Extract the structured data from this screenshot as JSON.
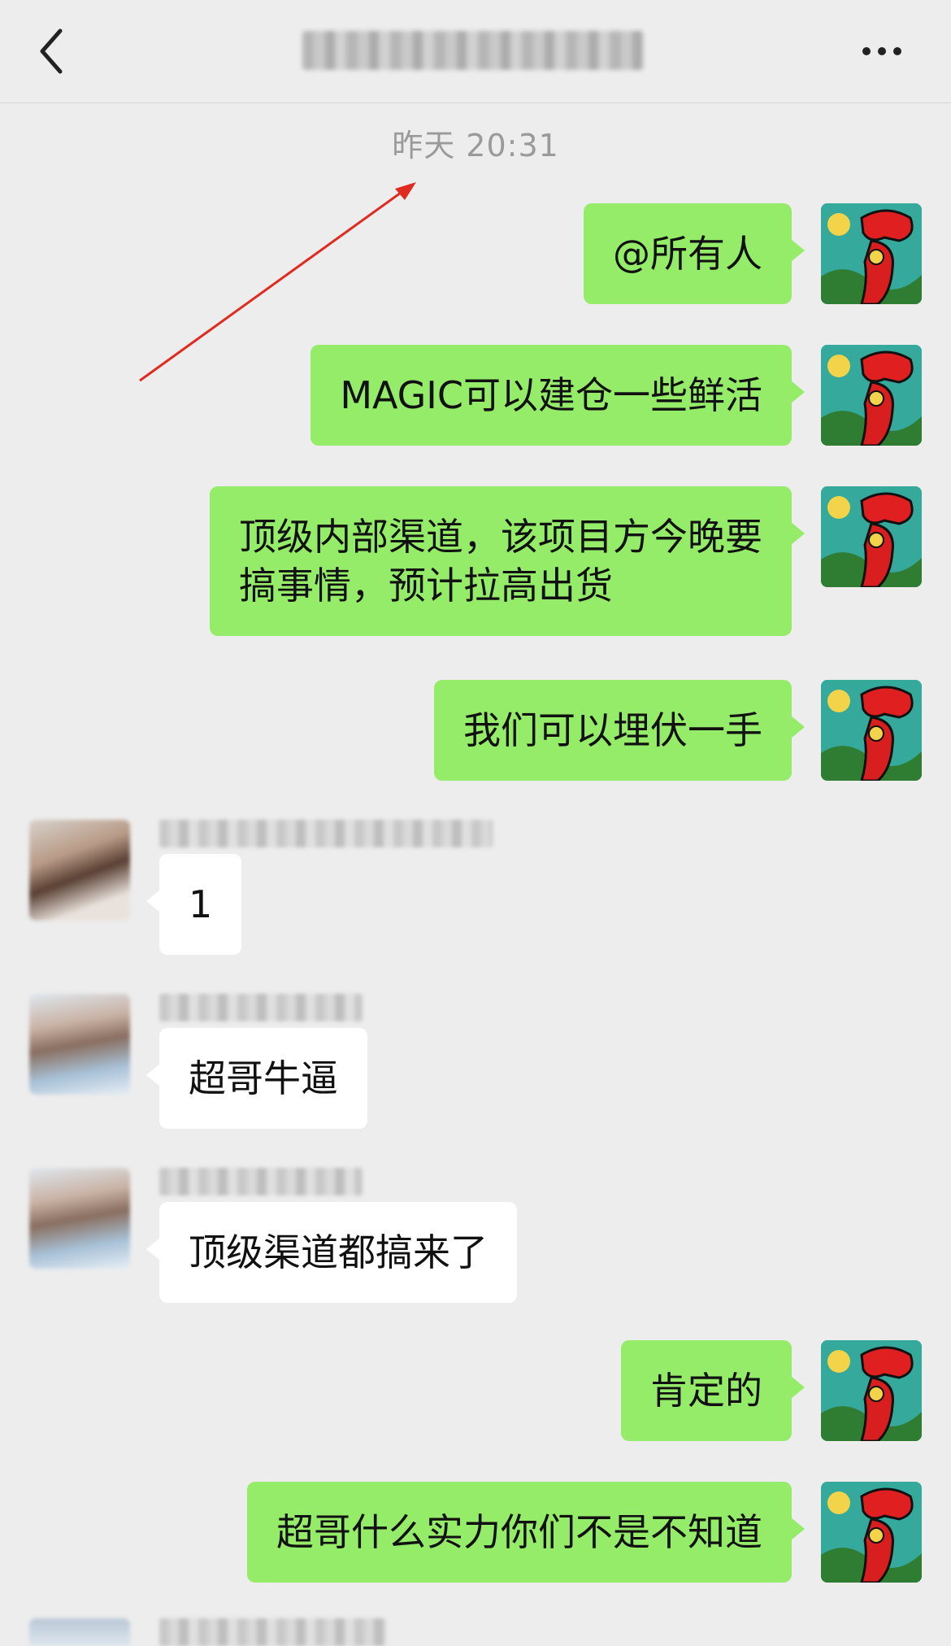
{
  "header": {
    "back_icon": "chevron-left-icon",
    "more_icon": "more-dots-icon"
  },
  "timestamp": "昨天 20:31",
  "messages": [
    {
      "direction": "out",
      "text": "@所有人"
    },
    {
      "direction": "out",
      "text": "MAGIC可以建仓一些鲜活"
    },
    {
      "direction": "out",
      "text_line1": "顶级内部渠道，该项目方今晚要",
      "text_line2": "搞事情，预计拉高出货"
    },
    {
      "direction": "out",
      "text": "我们可以埋伏一手"
    },
    {
      "direction": "in",
      "text": "1"
    },
    {
      "direction": "in",
      "text": "超哥牛逼"
    },
    {
      "direction": "in",
      "text": "顶级渠道都搞来了"
    },
    {
      "direction": "out",
      "text": "肯定的"
    },
    {
      "direction": "out",
      "text": "超哥什么实力你们不是不知道"
    }
  ],
  "colors": {
    "background": "#ededed",
    "outgoing_bubble": "#95ec69",
    "incoming_bubble": "#ffffff",
    "annotation_arrow": "#e02b20"
  }
}
